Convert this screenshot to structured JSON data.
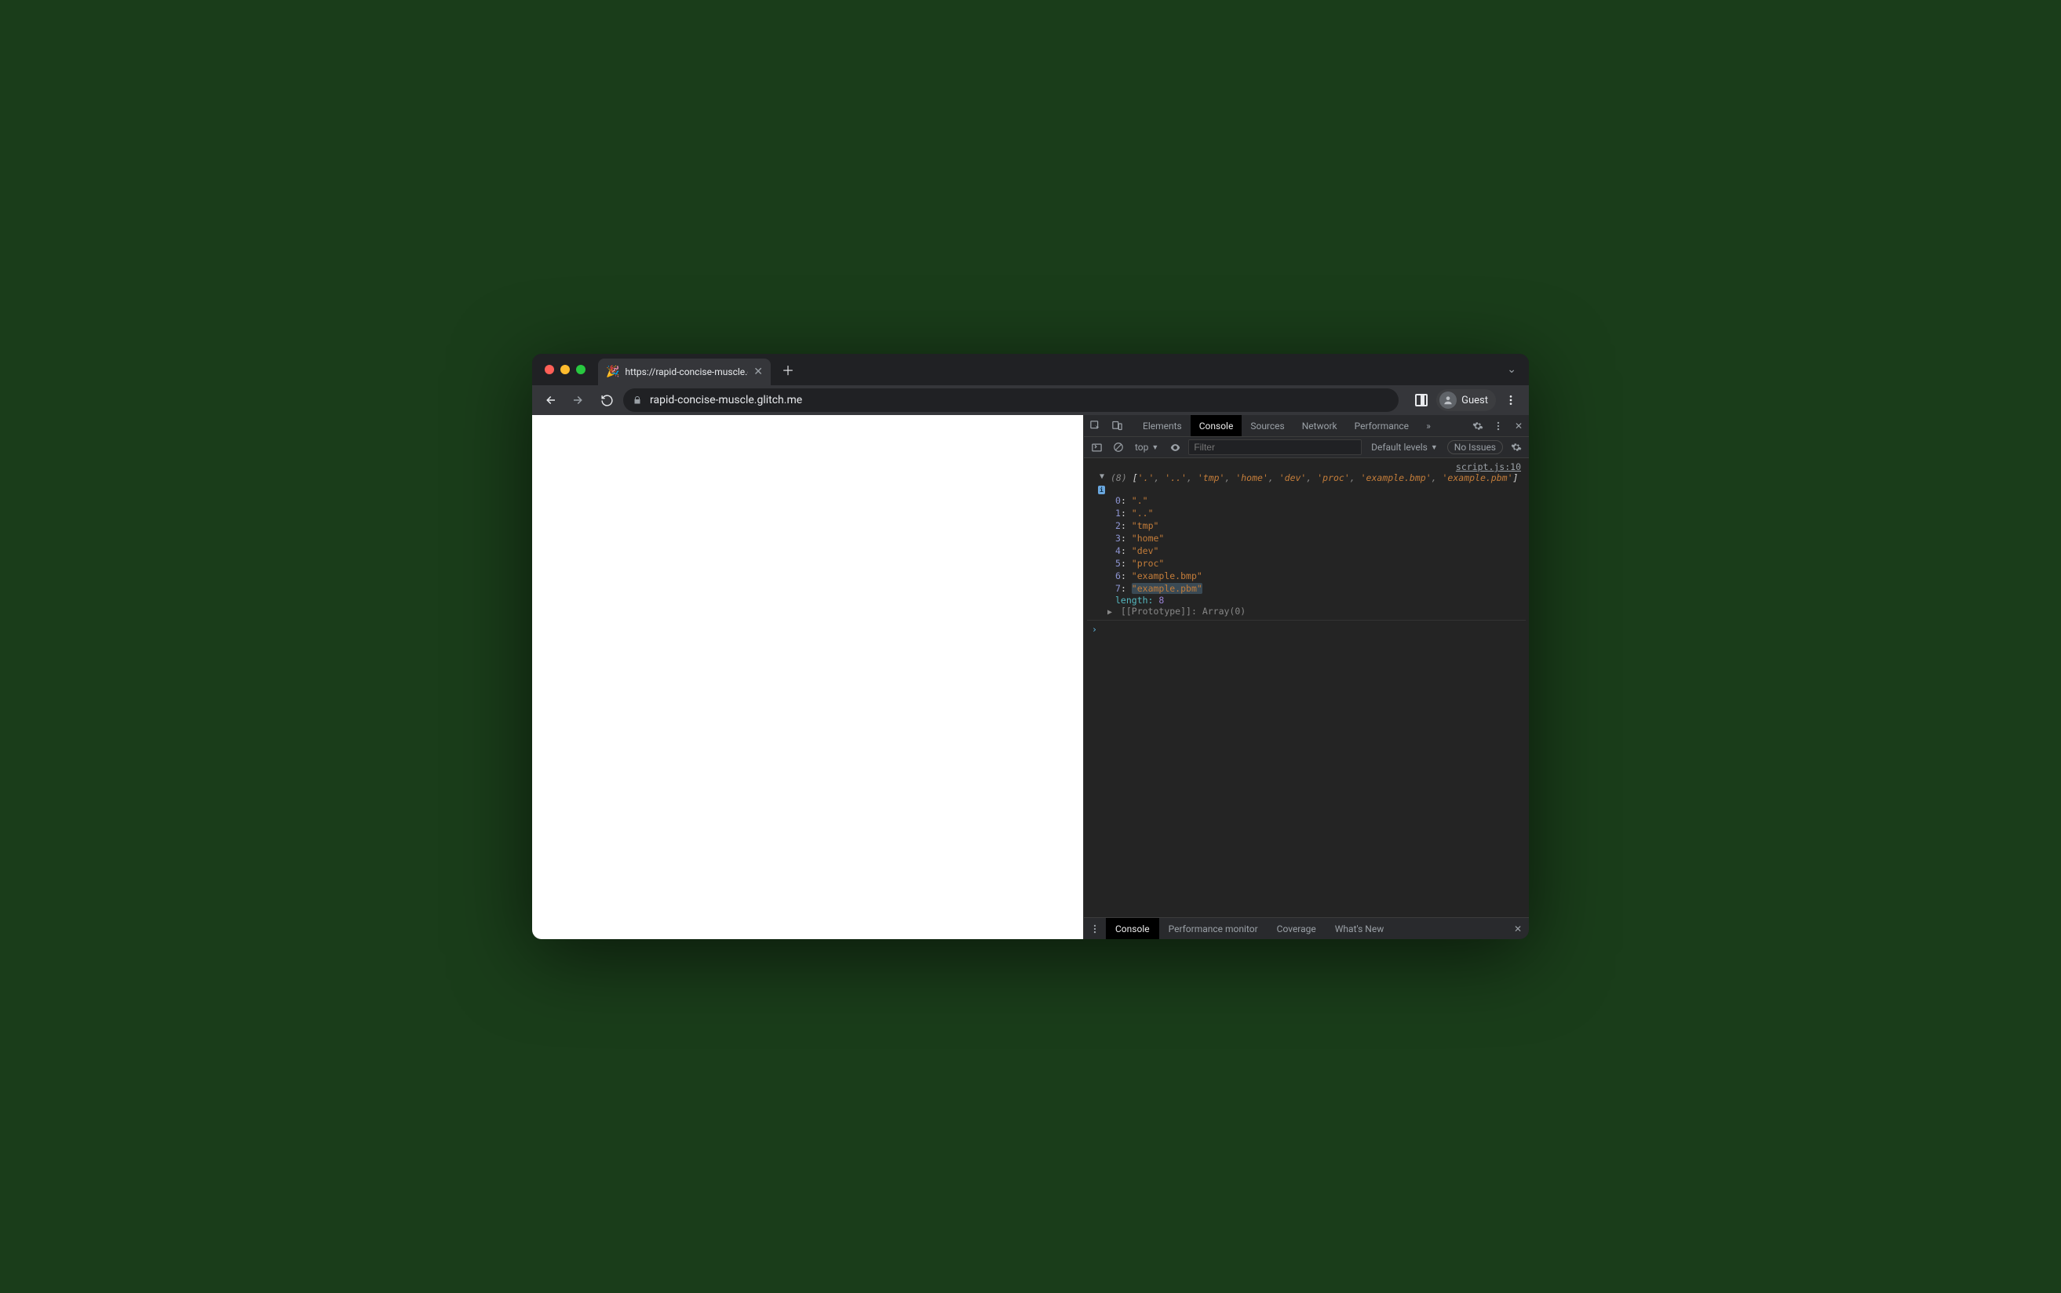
{
  "browser": {
    "tab_title": "https://rapid-concise-muscle.g",
    "tab_favicon": "🎉",
    "url": "rapid-concise-muscle.glitch.me",
    "guest_label": "Guest"
  },
  "devtools": {
    "tabs": [
      "Elements",
      "Console",
      "Sources",
      "Network",
      "Performance"
    ],
    "active_tab": "Console",
    "console_toolbar": {
      "context": "top",
      "filter_placeholder": "Filter",
      "levels_label": "Default levels",
      "issues_label": "No Issues"
    },
    "console": {
      "source_link": "script.js:10",
      "array_length_label": "(8)",
      "summary_items": [
        ".",
        "..",
        "tmp",
        "home",
        "dev",
        "proc",
        "example.bmp",
        "example.pbm"
      ],
      "items": [
        {
          "index": "0",
          "value": "\".\""
        },
        {
          "index": "1",
          "value": "\"..\""
        },
        {
          "index": "2",
          "value": "\"tmp\""
        },
        {
          "index": "3",
          "value": "\"home\""
        },
        {
          "index": "4",
          "value": "\"dev\""
        },
        {
          "index": "5",
          "value": "\"proc\""
        },
        {
          "index": "6",
          "value": "\"example.bmp\""
        },
        {
          "index": "7",
          "value": "\"example.pbm\"",
          "highlighted": true
        }
      ],
      "length_key": "length",
      "length_value": "8",
      "prototype_label": "[[Prototype]]",
      "prototype_value": "Array(0)",
      "prompt": "›"
    },
    "drawer": {
      "tabs": [
        "Console",
        "Performance monitor",
        "Coverage",
        "What's New"
      ],
      "active": "Console"
    }
  }
}
